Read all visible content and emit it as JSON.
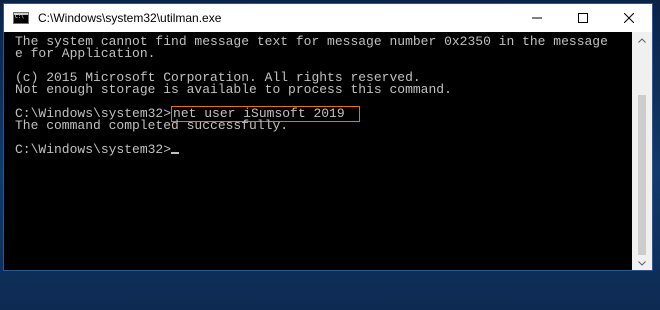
{
  "window": {
    "title": "C:\\Windows\\system32\\utilman.exe",
    "buttons": {
      "minimize_icon": "minimize-icon",
      "maximize_icon": "maximize-icon",
      "close_icon": "close-icon"
    }
  },
  "console": {
    "lines": [
      "The system cannot find message text for message number 0x2350 in the message",
      "e for Application.",
      "",
      "(c) 2015 Microsoft Corporation. All rights reserved.",
      "Not enough storage is available to process this command.",
      ""
    ],
    "prompt1": "C:\\Windows\\system32>",
    "command": "net user iSumsoft 2019",
    "result": "The command completed successfully.",
    "prompt2": "C:\\Windows\\system32>"
  },
  "colors": {
    "console_bg": "#000000",
    "console_text": "#c0c0c0",
    "highlight_border": "#e07030",
    "titlebar_bg": "#ffffff"
  },
  "scrollbar": {
    "position_fraction": 1.0
  }
}
